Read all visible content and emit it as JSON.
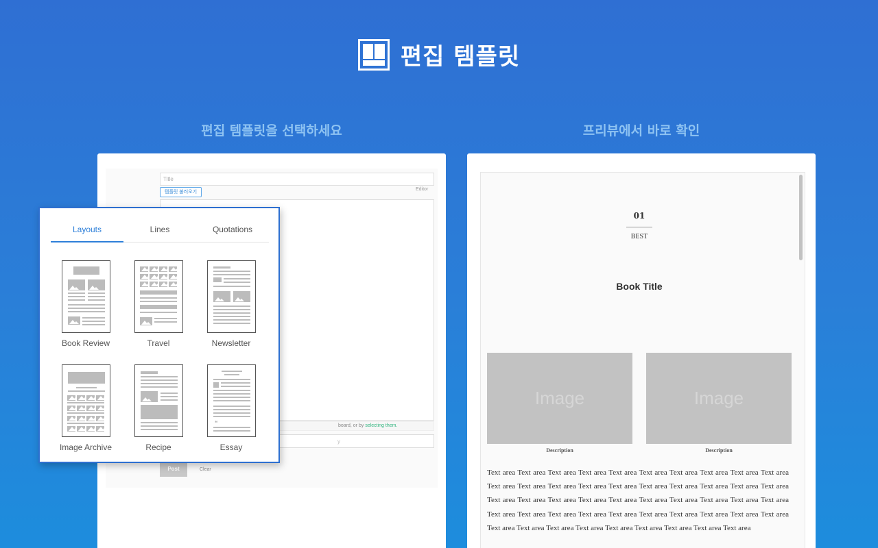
{
  "header": {
    "title": "편집 템플릿",
    "logo": "template-layout-icon"
  },
  "left": {
    "subtitle": "편집 템플릿을 선택하세요"
  },
  "right": {
    "subtitle": "프리뷰에서 바로 확인"
  },
  "editor": {
    "title_placeholder": "Title",
    "template_button": "템플릿 불러오기",
    "editor_label": "Editor",
    "drop_note_prefix": "board, or by ",
    "drop_note_link": "selecting them.",
    "second_hint": "y",
    "post_button": "Post",
    "clear_button": "Clear"
  },
  "popup": {
    "tabs": [
      {
        "label": "Layouts",
        "active": true
      },
      {
        "label": "Lines",
        "active": false
      },
      {
        "label": "Quotations",
        "active": false
      }
    ],
    "templates": [
      {
        "label": "Book Review"
      },
      {
        "label": "Travel"
      },
      {
        "label": "Newsletter"
      },
      {
        "label": "Image Archive"
      },
      {
        "label": "Recipe"
      },
      {
        "label": "Essay"
      }
    ]
  },
  "preview": {
    "number": "01",
    "badge": "BEST",
    "book_title": "Book Title",
    "image_label": "Image",
    "description": "Description",
    "text": "Text area Text area Text area Text area Text area Text area Text area Text area Text area Text area Text area Text area Text area Text area Text area Text area Text area Text area Text area Text area Text area Text area Text area Text area Text area Text area Text area Text area Text area Text area Text area Text area Text area Text area Text area Text area Text area Text area Text area Text area Text area Text area Text area Text area Text area Text area Text area Text area Text area"
  },
  "colors": {
    "accent": "#2d7fd9",
    "background_top": "#2f6fd3",
    "background_bottom": "#1d8ddd"
  }
}
